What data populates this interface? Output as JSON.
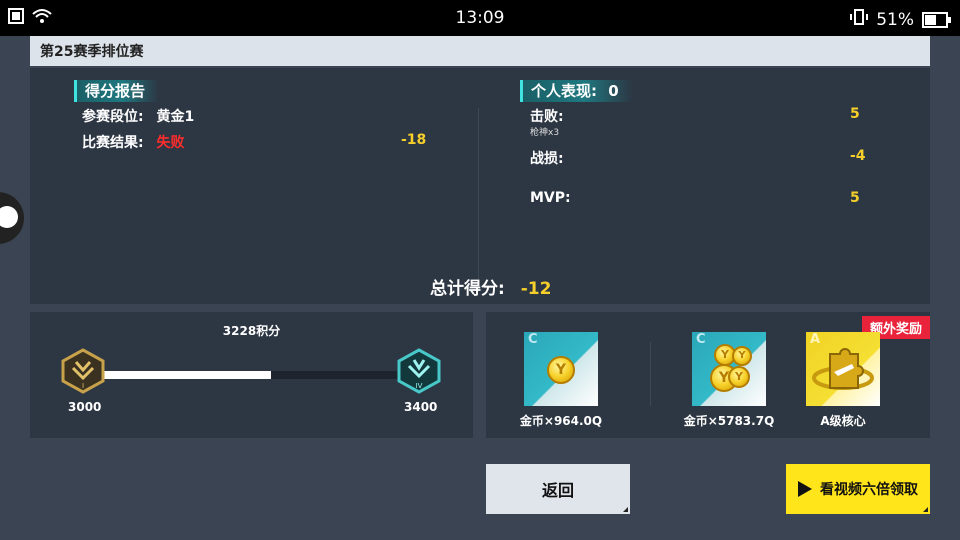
{
  "status": {
    "time": "13:09",
    "battery": "51%",
    "battery_level": 0.51
  },
  "title": "第25赛季排位赛",
  "score_report": {
    "tag": "得分报告",
    "rank_label": "参赛段位:",
    "rank_value": "黄金1",
    "result_label": "比赛结果:",
    "result_value": "失败",
    "result_points": "-18"
  },
  "personal": {
    "tag": "个人表现:",
    "tag_value": "0",
    "kills_label": "击败:",
    "kills_sub": "枪神x3",
    "kills_value": "5",
    "deaths_label": "战损:",
    "deaths_value": "-4",
    "mvp_label": "MVP:",
    "mvp_value": "5"
  },
  "total": {
    "label": "总计得分:",
    "value": "-12"
  },
  "progress": {
    "points_text": "3228积分",
    "min_label": "3000",
    "max_label": "3400",
    "current_value": 3228,
    "min_value": 3000,
    "max_value": 3400,
    "left_badge_numeral": "I",
    "right_badge_numeral": "IV"
  },
  "rewards": {
    "bonus_tag": "额外奖励",
    "items": [
      {
        "grade": "C",
        "label": "金币×964.0Q"
      },
      {
        "grade": "C",
        "label": "金币×5783.7Q"
      },
      {
        "grade": "A",
        "label": "A级核心"
      }
    ]
  },
  "buttons": {
    "back": "返回",
    "video": "看视频六倍领取"
  },
  "colors": {
    "accent_teal": "#3fe3e0",
    "red": "#ff2c2c",
    "yellow": "#f6cf2a",
    "button_yellow": "#ffe51a"
  }
}
